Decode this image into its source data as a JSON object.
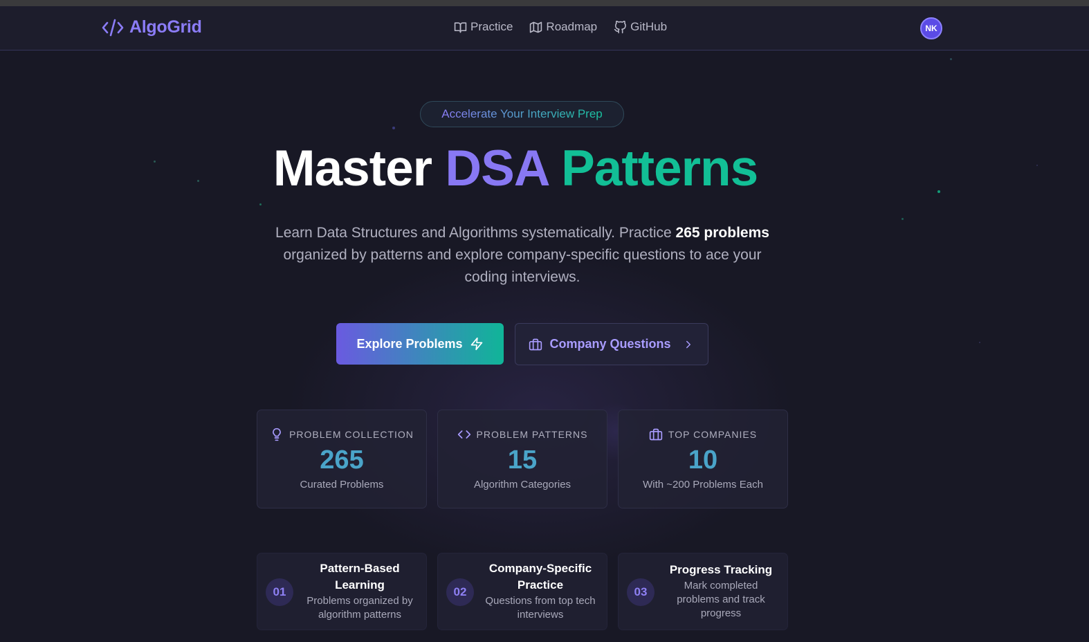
{
  "navbar": {
    "logo_text": "AlgoGrid",
    "logo_icon": "code-icon",
    "links": [
      {
        "label": "Practice",
        "icon": "book-open-icon"
      },
      {
        "label": "Roadmap",
        "icon": "map-icon"
      },
      {
        "label": "GitHub",
        "icon": "github-icon"
      }
    ],
    "avatar_initials": "NK"
  },
  "hero": {
    "badge": "Accelerate Your Interview Prep",
    "headline": {
      "part1": "Master",
      "part2": "DSA",
      "part3": "Patterns"
    },
    "subtext_before": "Learn Data Structures and Algorithms systematically. Practice ",
    "subtext_bold": "265 problems",
    "subtext_after": " organized by patterns and explore company-specific questions to ace your coding interviews."
  },
  "buttons": {
    "primary": "Explore Problems",
    "secondary": "Company Questions"
  },
  "stats": [
    {
      "heading": "PROBLEM COLLECTION",
      "value": "265",
      "label": "Curated Problems",
      "icon": "lightbulb-icon"
    },
    {
      "heading": "PROBLEM PATTERNS",
      "value": "15",
      "label": "Algorithm Categories",
      "icon": "code-icon"
    },
    {
      "heading": "TOP COMPANIES",
      "value": "10",
      "label": "With ~200 Problems Each",
      "icon": "briefcase-icon"
    }
  ],
  "features": [
    {
      "num": "01",
      "title": "Pattern-Based Learning",
      "desc": "Problems organized by algorithm patterns"
    },
    {
      "num": "02",
      "title": "Company-Specific Practice",
      "desc": "Questions from top tech interviews"
    },
    {
      "num": "03",
      "title": "Progress Tracking",
      "desc": "Mark completed problems and track progress"
    }
  ],
  "colors": {
    "background": "#181825",
    "accent_purple": "#8878f3",
    "accent_green": "#12bf96",
    "stat_value": "#4aa4c9"
  }
}
